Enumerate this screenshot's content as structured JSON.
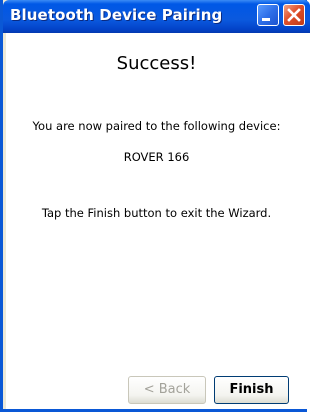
{
  "window": {
    "title": "Bluetooth Device Pairing"
  },
  "titlebar": {
    "minimize_icon": "minimize-icon",
    "close_icon": "close-icon"
  },
  "main": {
    "heading": "Success!",
    "intro_text": "You are now paired to the following device:",
    "device_name": "ROVER 166",
    "instruction_text": "Tap the Finish button to exit the Wizard."
  },
  "buttons": {
    "back_label": "< Back",
    "back_enabled": false,
    "finish_label": "Finish"
  },
  "colors": {
    "titlebar": "#0058e6",
    "close_button": "#e0502b",
    "window_frame": "#0a58d6"
  }
}
